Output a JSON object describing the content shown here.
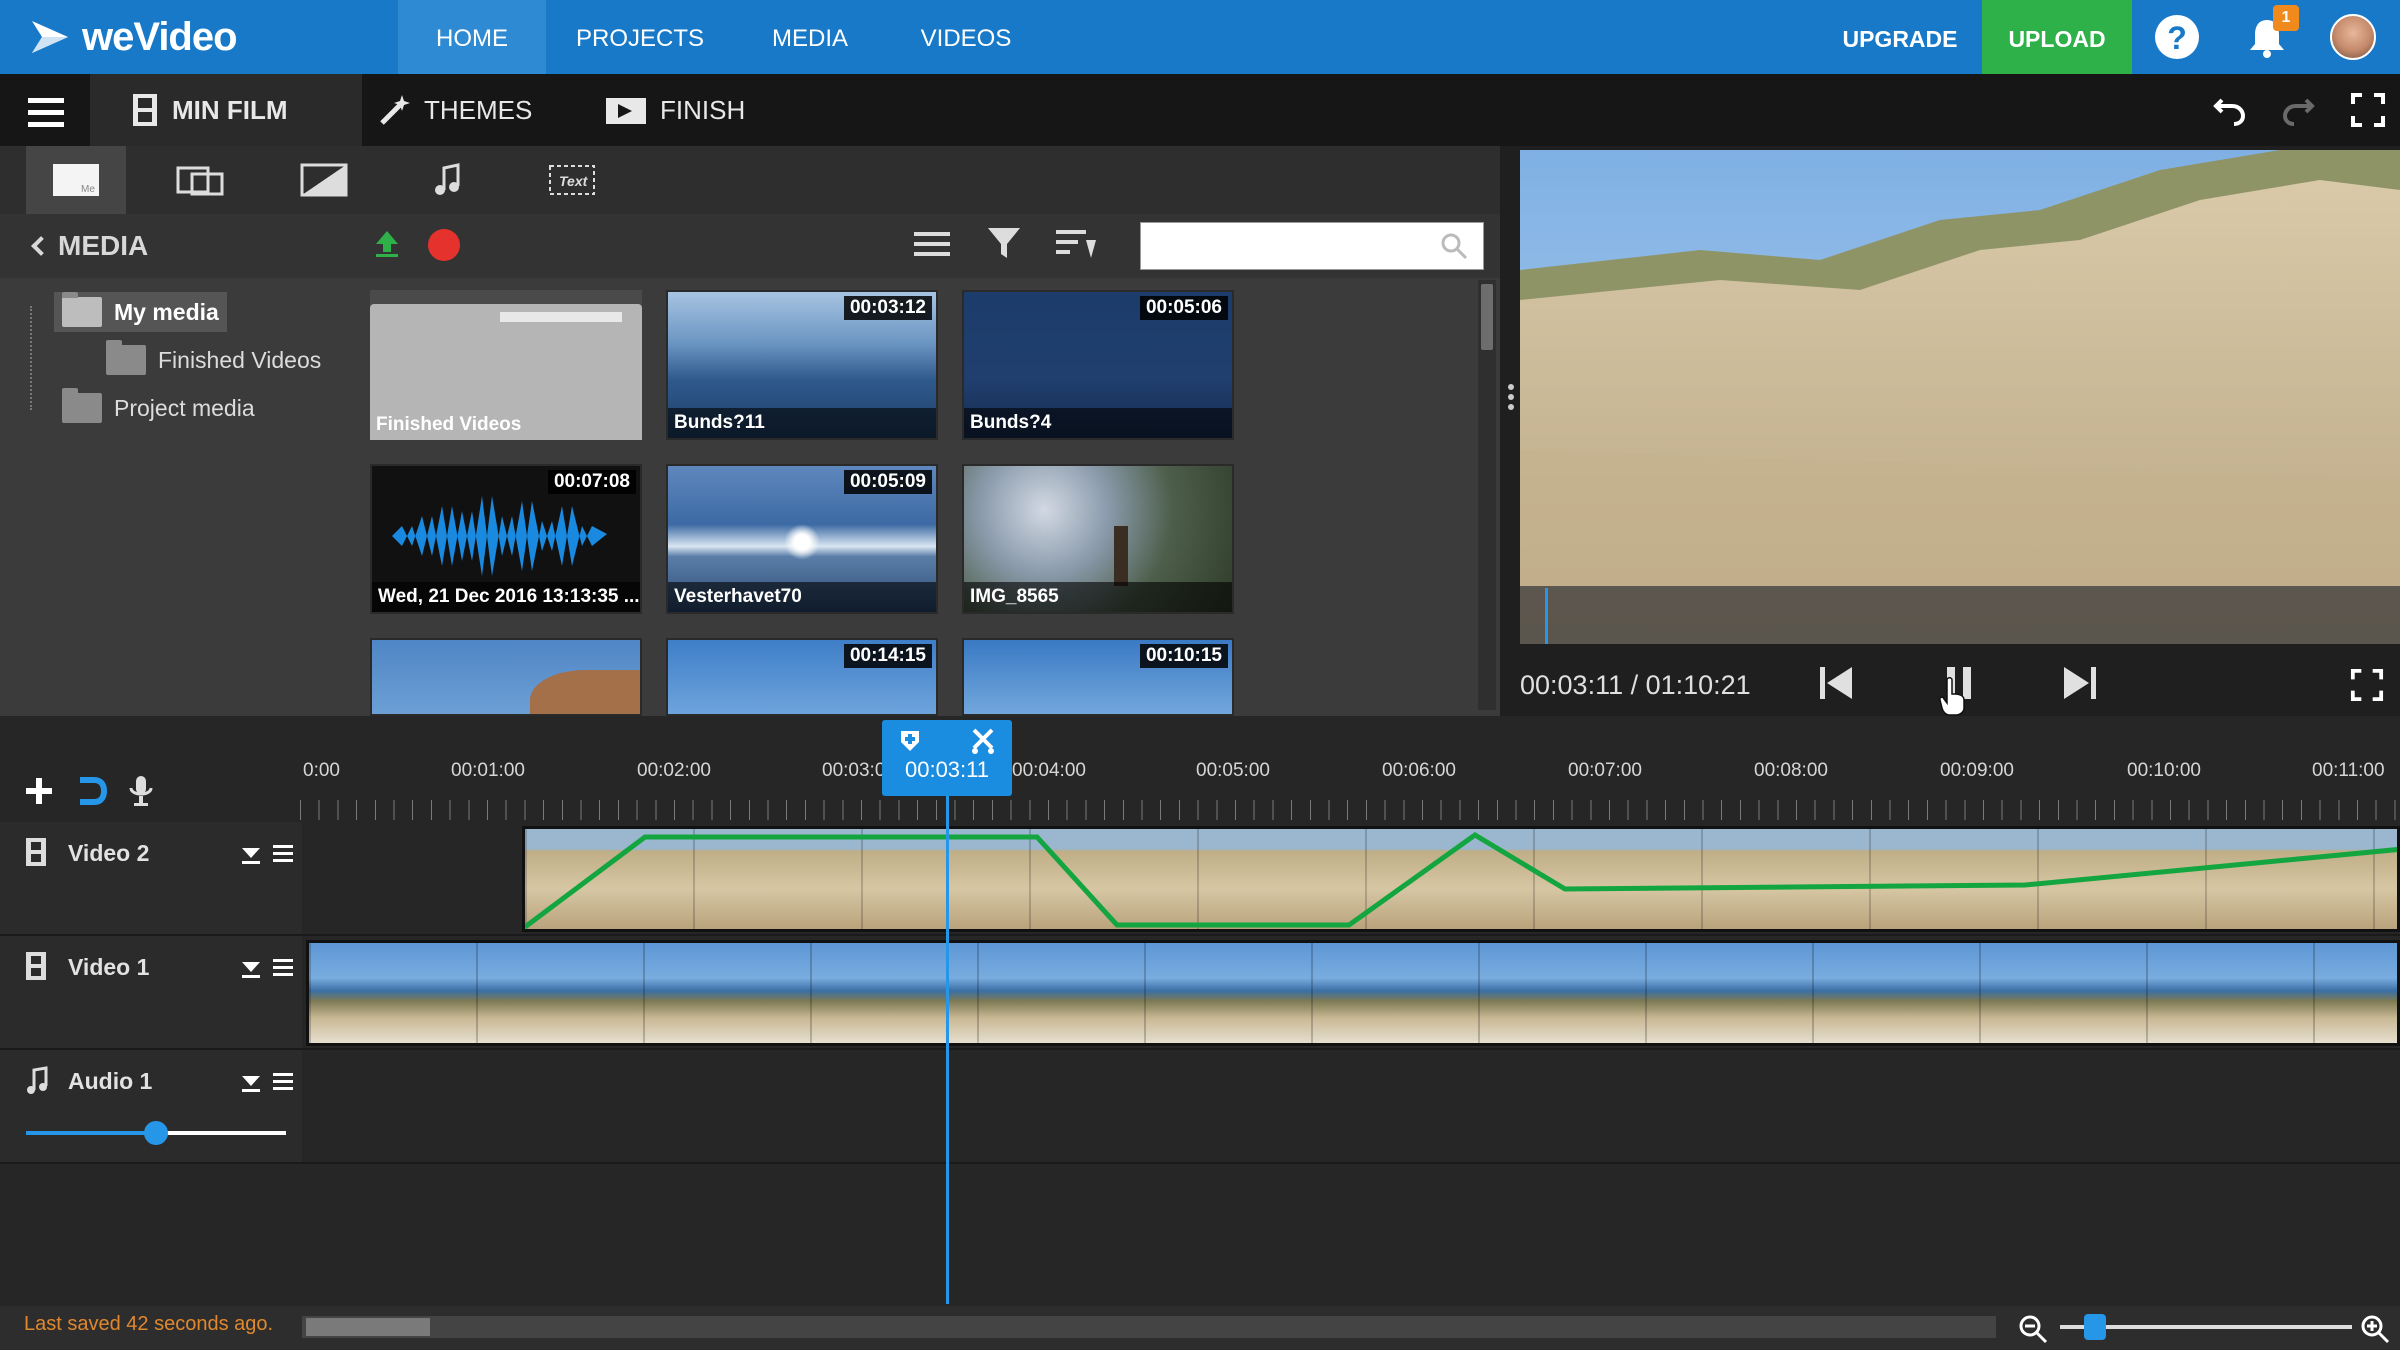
{
  "brand": {
    "name": "weVideo",
    "accent": "#1779c7",
    "upload_color": "#2fb14a"
  },
  "topnav": {
    "tabs": [
      {
        "label": "HOME",
        "active": true
      },
      {
        "label": "PROJECTS"
      },
      {
        "label": "MEDIA"
      },
      {
        "label": "VIDEOS"
      }
    ],
    "upgrade_label": "UPGRADE",
    "upload_label": "UPLOAD",
    "help_glyph": "?",
    "notification_count": "1"
  },
  "toolbar": {
    "tabs": [
      {
        "label": "MIN FILM",
        "icon": "film-icon",
        "active": true
      },
      {
        "label": "THEMES",
        "icon": "magic-wand-icon"
      },
      {
        "label": "FINISH",
        "icon": "clapper-icon"
      }
    ],
    "right_icons": [
      "undo-icon",
      "redo-icon",
      "fullscreen-icon"
    ]
  },
  "media_panel": {
    "strip_icons": [
      "media-tab-icon",
      "transitions-icon",
      "backgrounds-icon",
      "music-icon",
      "text-icon"
    ],
    "text_icon_label": "Text",
    "back_label": "MEDIA",
    "search": {
      "placeholder": "",
      "value": ""
    },
    "tree": [
      {
        "label": "My media",
        "selected": true,
        "level": 0
      },
      {
        "label": "Finished Videos",
        "level": 1
      },
      {
        "label": "Project media",
        "level": 0
      }
    ],
    "items": [
      {
        "name": "Finished Videos",
        "duration": "",
        "kind": "folder"
      },
      {
        "name": "Bunds?11",
        "duration": "00:03:12",
        "kind": "lake"
      },
      {
        "name": "Bunds?4",
        "duration": "00:05:06",
        "kind": "dark"
      },
      {
        "name": "Wed, 21 Dec 2016 13:13:35 ...",
        "duration": "00:07:08",
        "kind": "audio"
      },
      {
        "name": "Vesterhavet70",
        "duration": "00:05:09",
        "kind": "sun"
      },
      {
        "name": "IMG_8565",
        "duration": "",
        "kind": "bird"
      },
      {
        "name": "",
        "duration": "",
        "kind": "sky"
      },
      {
        "name": "",
        "duration": "00:14:15",
        "kind": "sky"
      },
      {
        "name": "",
        "duration": "00:10:15",
        "kind": "sky"
      }
    ]
  },
  "preview": {
    "timecode": "00:03:11 / 01:10:21",
    "controls": [
      "skip-back-icon",
      "pause-icon",
      "skip-forward-icon",
      "fullscreen-icon"
    ]
  },
  "timeline": {
    "playhead": "00:03:11",
    "ruler_labels": [
      "0:00",
      "00:01:00",
      "00:02:00",
      "00:03:00",
      "00:04:00",
      "00:05:00",
      "00:06:00",
      "00:07:00",
      "00:08:00",
      "00:09:00",
      "00:10:00",
      "00:11:00"
    ],
    "tracks": [
      {
        "name": "Video 2",
        "type": "video"
      },
      {
        "name": "Video 1",
        "type": "video"
      },
      {
        "name": "Audio 1",
        "type": "audio"
      }
    ],
    "audio_volume": 0.5
  },
  "status": {
    "saved_text": "Last saved 42 seconds ago.",
    "saved_color": "#e0882e"
  }
}
